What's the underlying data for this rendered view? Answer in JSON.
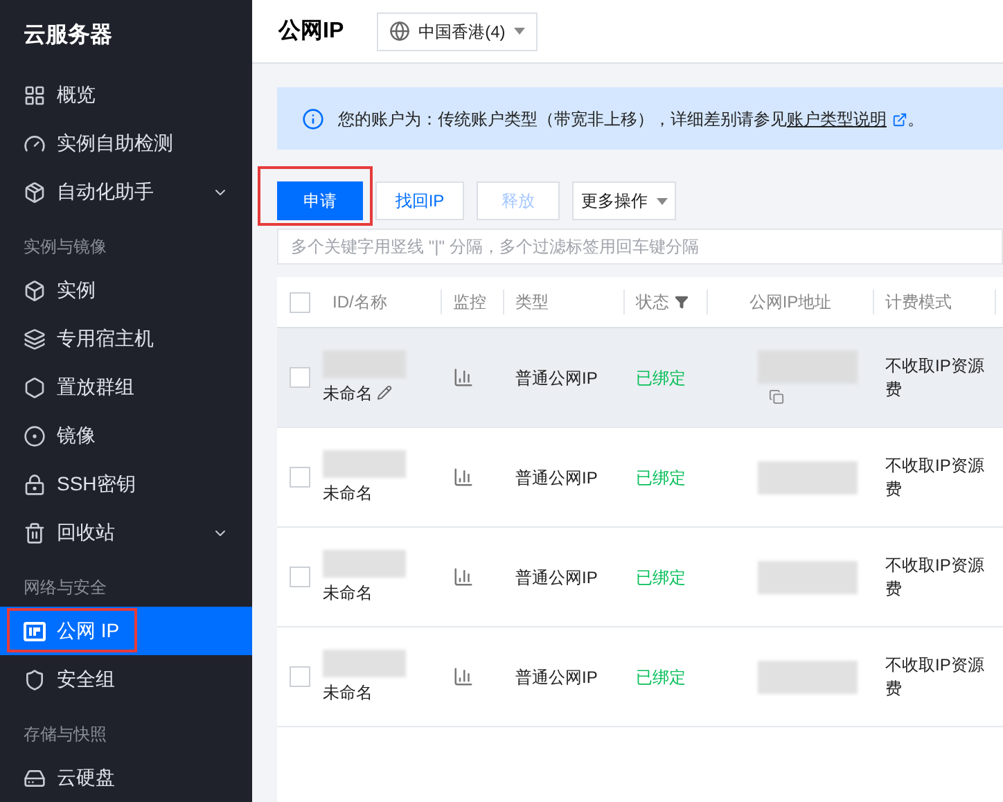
{
  "sidebar": {
    "title": "云服务器",
    "items": [
      {
        "kind": "item",
        "label": "概览",
        "selected": false,
        "expandable": false,
        "highlighted": false
      },
      {
        "kind": "item",
        "label": "实例自助检测",
        "selected": false,
        "expandable": false,
        "highlighted": false
      },
      {
        "kind": "item",
        "label": "自动化助手",
        "selected": false,
        "expandable": true,
        "highlighted": false
      },
      {
        "kind": "section",
        "label": "实例与镜像"
      },
      {
        "kind": "item",
        "label": "实例",
        "selected": false,
        "expandable": false,
        "highlighted": false
      },
      {
        "kind": "item",
        "label": "专用宿主机",
        "selected": false,
        "expandable": false,
        "highlighted": false
      },
      {
        "kind": "item",
        "label": "置放群组",
        "selected": false,
        "expandable": false,
        "highlighted": false
      },
      {
        "kind": "item",
        "label": "镜像",
        "selected": false,
        "expandable": false,
        "highlighted": false
      },
      {
        "kind": "item",
        "label": "SSH密钥",
        "selected": false,
        "expandable": false,
        "highlighted": false
      },
      {
        "kind": "item",
        "label": "回收站",
        "selected": false,
        "expandable": true,
        "highlighted": false
      },
      {
        "kind": "section",
        "label": "网络与安全"
      },
      {
        "kind": "item",
        "label": "公网 IP",
        "selected": true,
        "expandable": false,
        "highlighted": true
      },
      {
        "kind": "item",
        "label": "安全组",
        "selected": false,
        "expandable": false,
        "highlighted": false
      },
      {
        "kind": "section",
        "label": "存储与快照"
      },
      {
        "kind": "item",
        "label": "云硬盘",
        "selected": false,
        "expandable": false,
        "highlighted": false
      }
    ]
  },
  "header": {
    "title": "公网IP",
    "region": "中国香港(4)"
  },
  "notice": {
    "text": "您的账户为：传统账户类型（带宽非上移），详细差别请参见",
    "link": "账户类型说明",
    "end": "。"
  },
  "buttons": [
    {
      "label": "申请",
      "kind": "primary",
      "disabled": false,
      "highlighted": true
    },
    {
      "label": "找回IP",
      "kind": "default",
      "disabled": false,
      "highlighted": false
    },
    {
      "label": "释放",
      "kind": "default",
      "disabled": true,
      "highlighted": false
    },
    {
      "label": "更多操作",
      "kind": "dropdown",
      "disabled": false,
      "highlighted": false
    }
  ],
  "search": {
    "placeholder": "多个关键字用竖线 \"|\" 分隔，多个过滤标签用回车键分隔"
  },
  "table": {
    "all_checked": false,
    "columns": [
      {
        "label": "ID/名称",
        "filter": false
      },
      {
        "label": "监控",
        "filter": false
      },
      {
        "label": "类型",
        "filter": false
      },
      {
        "label": "状态",
        "filter": true
      },
      {
        "label": "公网IP地址",
        "filter": false
      },
      {
        "label": "计费模式",
        "filter": false
      }
    ],
    "rows": [
      {
        "name": "未命名",
        "type": "普通公网IP",
        "status": "已绑定",
        "billing": "不收取IP资源费",
        "hovered": true,
        "checked": false
      },
      {
        "name": "未命名",
        "type": "普通公网IP",
        "status": "已绑定",
        "billing": "不收取IP资源费",
        "hovered": false,
        "checked": false
      },
      {
        "name": "未命名",
        "type": "普通公网IP",
        "status": "已绑定",
        "billing": "不收取IP资源费",
        "hovered": false,
        "checked": false
      },
      {
        "name": "未命名",
        "type": "普通公网IP",
        "status": "已绑定",
        "billing": "不收取IP资源费",
        "hovered": false,
        "checked": false
      }
    ]
  }
}
